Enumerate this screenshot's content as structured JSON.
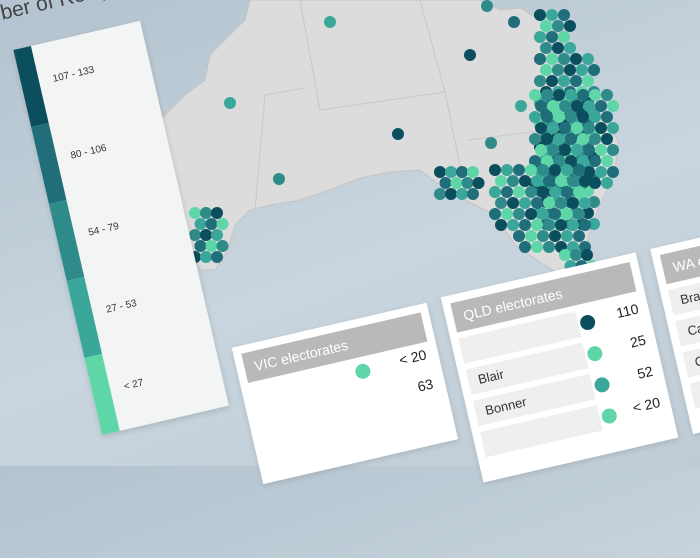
{
  "legend": {
    "title": "ber of Recipients",
    "bins": [
      {
        "label": "107 - 133",
        "color": "#0b4e5d"
      },
      {
        "label": "80 - 106",
        "color": "#1f6e79"
      },
      {
        "label": "54 - 79",
        "color": "#2f8b8a"
      },
      {
        "label": "27 - 53",
        "color": "#3aa79a"
      },
      {
        "label": "< 27",
        "color": "#5fd6a8"
      }
    ]
  },
  "map": {
    "dot_colors": [
      "#0b4e5d",
      "#1f6e79",
      "#2f8b8a",
      "#3aa79a",
      "#5fd6a8"
    ]
  },
  "tables": {
    "vic": {
      "title": "VIC electorates",
      "values": [
        "< 20",
        "63"
      ]
    },
    "qld": {
      "title": "QLD electorates",
      "rows": [
        {
          "label": "",
          "value": "110",
          "color": "#0b4e5d"
        },
        {
          "label": "Blair",
          "value": "25",
          "color": "#5fd6a8"
        },
        {
          "label": "Bonner",
          "value": "52",
          "color": "#3aa79a"
        },
        {
          "label": "",
          "value": "< 20",
          "color": "#5fd6a8"
        }
      ]
    },
    "wa": {
      "title": "WA electo",
      "rows": [
        {
          "label": "Brand"
        },
        {
          "label": "Cannin"
        },
        {
          "label": "Cow"
        },
        {
          "label": ""
        }
      ]
    }
  }
}
